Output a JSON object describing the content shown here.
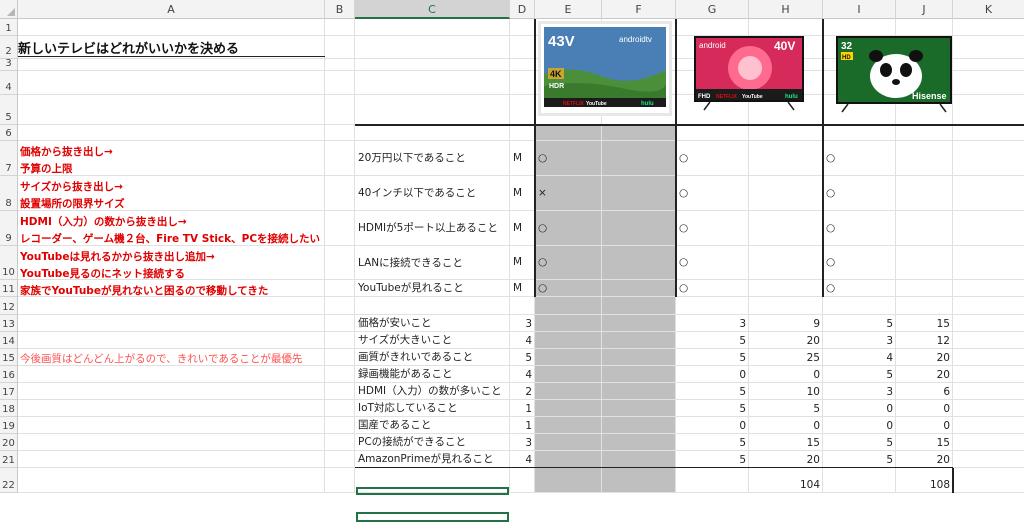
{
  "columns": [
    "A",
    "B",
    "C",
    "D",
    "E",
    "F",
    "G",
    "H",
    "I",
    "J",
    "K"
  ],
  "rows": [
    "1",
    "2",
    "3",
    "4",
    "5",
    "6",
    "7",
    "8",
    "9",
    "10",
    "11",
    "12",
    "13",
    "14",
    "15",
    "16",
    "17",
    "18",
    "19",
    "20",
    "21",
    "22"
  ],
  "title": "新しいテレビはどれがいいかを決める",
  "notes": {
    "r7a": "価格から抜き出し→",
    "r7b": "予算の上限",
    "r8a": "サイズから抜き出し→",
    "r8b": "設置場所の限界サイズ",
    "r9a": "HDMI（入力）の数から抜き出し→",
    "r9b": "レコーダー、ゲーム機２台、Fire TV Stick、PCを接続したい",
    "r10a": "YouTubeは見れるかから抜き出し追加→",
    "r10b": "YouTube見るのにネット接続する",
    "r11": "家族でYouTubeが見れないと困るので移動してきた",
    "r15": "今後画質はどんどん上がるので、きれいであることが最優先"
  },
  "must": [
    {
      "label": "20万円以下であること",
      "flag": "M",
      "e": "○",
      "g": "○",
      "i": "○"
    },
    {
      "label": "40インチ以下であること",
      "flag": "M",
      "e": "×",
      "g": "○",
      "i": "○"
    },
    {
      "label": "HDMIが5ポート以上あること",
      "flag": "M",
      "e": "○",
      "g": "○",
      "i": "○"
    },
    {
      "label": "LANに接続できること",
      "flag": "M",
      "e": "○",
      "g": "○",
      "i": "○"
    },
    {
      "label": "YouTubeが見れること",
      "flag": "M",
      "e": "○",
      "g": "○",
      "i": "○"
    }
  ],
  "want": [
    {
      "label": "価格が安いこと",
      "w": "3",
      "g": "3",
      "h": "9",
      "i": "5",
      "j": "15"
    },
    {
      "label": "サイズが大きいこと",
      "w": "4",
      "g": "5",
      "h": "20",
      "i": "3",
      "j": "12"
    },
    {
      "label": "画質がきれいであること",
      "w": "5",
      "g": "5",
      "h": "25",
      "i": "4",
      "j": "20"
    },
    {
      "label": "録画機能があること",
      "w": "4",
      "g": "0",
      "h": "0",
      "i": "5",
      "j": "20"
    },
    {
      "label": "HDMI（入力）の数が多いこと",
      "w": "2",
      "g": "5",
      "h": "10",
      "i": "3",
      "j": "6"
    },
    {
      "label": "IoT対応していること",
      "w": "1",
      "g": "5",
      "h": "5",
      "i": "0",
      "j": "0"
    },
    {
      "label": "国産であること",
      "w": "1",
      "g": "0",
      "h": "0",
      "i": "0",
      "j": "0"
    },
    {
      "label": "PCの接続ができること",
      "w": "3",
      "g": "5",
      "h": "15",
      "i": "5",
      "j": "15"
    },
    {
      "label": "AmazonPrimeが見れること",
      "w": "4",
      "g": "5",
      "h": "20",
      "i": "5",
      "j": "20"
    }
  ],
  "totals": {
    "h": "104",
    "j": "108"
  },
  "tv1": {
    "size": "43V",
    "brand": "androidtv",
    "badge": "4K",
    "hdr": "HDR",
    "apps": [
      "NETFLIX",
      "YouTube",
      "hulu"
    ],
    "colors": {
      "sky": "#4a7fb5",
      "grass": "#4c8f3a"
    }
  },
  "tv2": {
    "size": "40V",
    "brand": "android",
    "badge": "FHD",
    "apps": [
      "NETFLIX",
      "YouTube",
      "hulu"
    ],
    "colors": {
      "bg": "#d62b5a"
    }
  },
  "tv3": {
    "size": "32",
    "brand": "Hisense",
    "badge": "HD",
    "colors": {
      "bg": "#1a6b2a"
    }
  }
}
